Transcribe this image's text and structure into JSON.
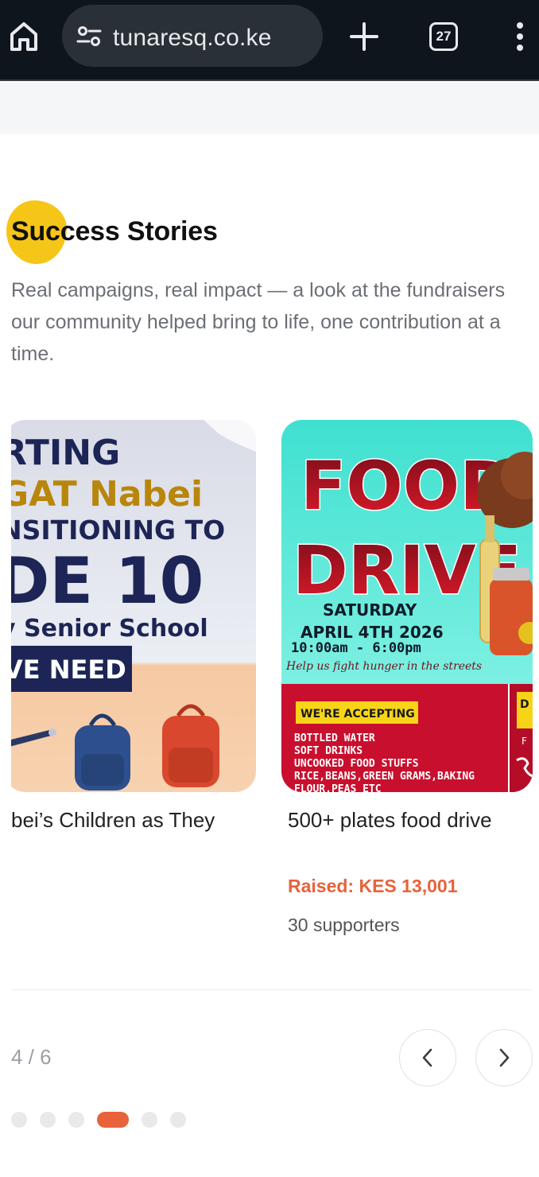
{
  "browser": {
    "url": "tunaresq.co.ke",
    "tab_count": "27"
  },
  "section": {
    "title": "Success Stories",
    "description": "Real campaigns, real impact — a look at the fundraisers our community helped bring to life, one contribution at a time."
  },
  "cards": [
    {
      "title": "bei’s Children as They",
      "poster": {
        "line1": "RTING",
        "line2": "GAT Nabei",
        "line3": "NSITIONING TO",
        "line4": "DE 10",
        "line5": "y Senior School",
        "banner": "VE NEED"
      }
    },
    {
      "title": "500+ plates food drive",
      "raised": "Raised: KES 13,001",
      "supporters": "30 supporters",
      "poster": {
        "headline1": "FOOD",
        "headline2": "DRIVE",
        "day": "SATURDAY",
        "date": "APRIL 4TH 2026",
        "time": "10:00am - 6:00pm",
        "tagline": "Help us fight hunger in the streets",
        "accepting": "WE'RE ACCEPTING",
        "items": [
          "BOTTLED WATER",
          "SOFT DRINKS",
          "UNCOOKED FOOD STUFFS",
          "RICE,BEANS,GREEN GRAMS,BAKING",
          "FLOUR,PEAS ETC"
        ],
        "side_text": "D h",
        "side_link": "F"
      }
    }
  ],
  "pager": {
    "counter": "4 / 6",
    "total_dots": 6,
    "active_index": 3
  },
  "colors": {
    "accent": "#e8623a",
    "highlight": "#f5c518",
    "chrome_bg": "#0e151c"
  }
}
